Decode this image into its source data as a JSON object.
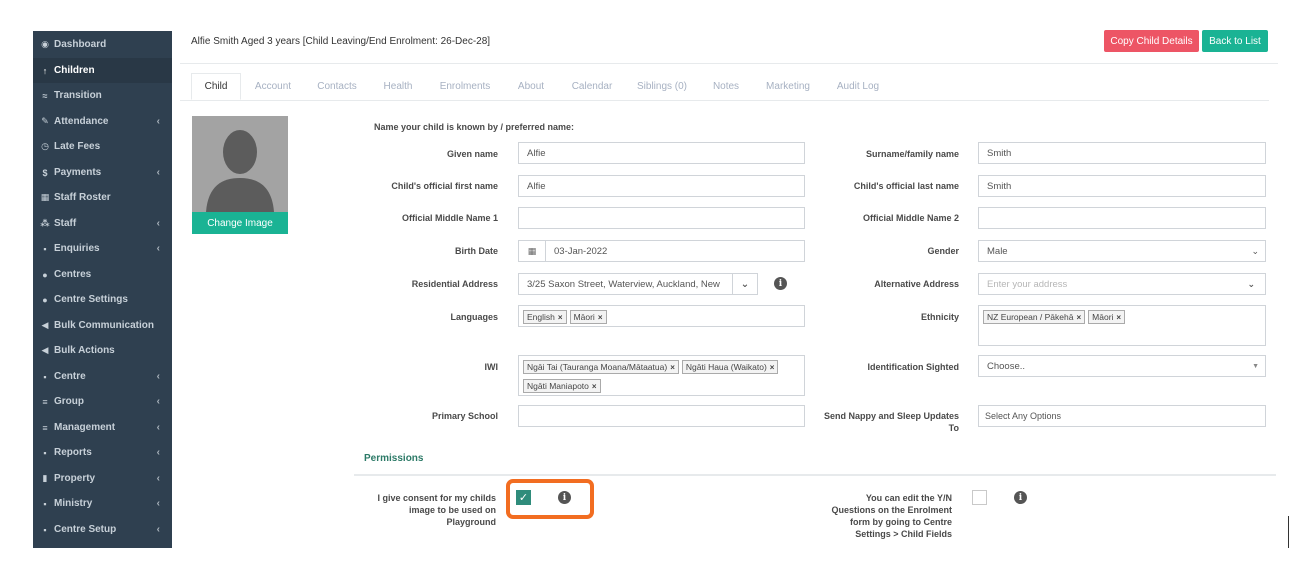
{
  "sidebar": {
    "items": [
      {
        "icon": "dashboard-icon",
        "glyph": "◉",
        "label": "Dashboard",
        "chevron": false
      },
      {
        "icon": "child-icon",
        "glyph": "↑",
        "label": "Children",
        "chevron": false,
        "active": true
      },
      {
        "icon": "graduation-icon",
        "glyph": "≈",
        "label": "Transition",
        "chevron": false
      },
      {
        "icon": "edit-icon",
        "glyph": "✎",
        "label": "Attendance",
        "chevron": true
      },
      {
        "icon": "clock-icon",
        "glyph": "◷",
        "label": "Late Fees",
        "chevron": false
      },
      {
        "icon": "dollar-icon",
        "glyph": "$",
        "label": "Payments",
        "chevron": true
      },
      {
        "icon": "calendar-icon",
        "glyph": "▦",
        "label": "Staff Roster",
        "chevron": false
      },
      {
        "icon": "sitemap-icon",
        "glyph": "⁂",
        "label": "Staff",
        "chevron": true
      },
      {
        "icon": "grid-icon",
        "glyph": "▪",
        "label": "Enquiries",
        "chevron": true
      },
      {
        "icon": "circle-icon",
        "glyph": "●",
        "label": "Centres",
        "chevron": false
      },
      {
        "icon": "circle-icon",
        "glyph": "●",
        "label": "Centre Settings",
        "chevron": false
      },
      {
        "icon": "bullhorn-icon",
        "glyph": "◀",
        "label": "Bulk Communication",
        "chevron": false
      },
      {
        "icon": "bullhorn-icon",
        "glyph": "◀",
        "label": "Bulk Actions",
        "chevron": false
      },
      {
        "icon": "grid-icon",
        "glyph": "▪",
        "label": "Centre",
        "chevron": true
      },
      {
        "icon": "list-icon",
        "glyph": "≡",
        "label": "Group",
        "chevron": true
      },
      {
        "icon": "list-icon",
        "glyph": "≡",
        "label": "Management",
        "chevron": true
      },
      {
        "icon": "grid-icon",
        "glyph": "▪",
        "label": "Reports",
        "chevron": true
      },
      {
        "icon": "building-icon",
        "glyph": "▮",
        "label": "Property",
        "chevron": true
      },
      {
        "icon": "grid-icon",
        "glyph": "▪",
        "label": "Ministry",
        "chevron": true
      },
      {
        "icon": "grid-icon",
        "glyph": "▪",
        "label": "Centre Setup",
        "chevron": true
      }
    ],
    "chevron_glyph": "‹"
  },
  "header": {
    "title": "Alfie Smith Aged 3 years [Child Leaving/End Enrolment: 26-Dec-28]",
    "copy_button": "Copy Child Details",
    "back_button": "Back to List"
  },
  "tabs": [
    "Child",
    "Account",
    "Contacts",
    "Health",
    "Enrolments",
    "About",
    "Calendar",
    "Siblings (0)",
    "Notes",
    "Marketing",
    "Audit Log"
  ],
  "avatar": {
    "change_image": "Change Image"
  },
  "form": {
    "preferred_heading": "Name your child is known by / preferred name:",
    "given_name_label": "Given name",
    "given_name": "Alfie",
    "surname_label": "Surname/family name",
    "surname": "Smith",
    "official_first_label": "Child's official first name",
    "official_first": "Alfie",
    "official_last_label": "Child's official last name",
    "official_last": "Smith",
    "middle1_label": "Official Middle Name 1",
    "middle2_label": "Official Middle Name 2",
    "birth_date_label": "Birth Date",
    "birth_date": "03-Jan-2022",
    "gender_label": "Gender",
    "gender": "Male",
    "residential_label": "Residential Address",
    "residential": "3/25 Saxon Street, Waterview, Auckland, New",
    "alt_address_label": "Alternative Address",
    "alt_address_placeholder": "Enter your address",
    "languages_label": "Languages",
    "languages": [
      "English",
      "Māori"
    ],
    "ethnicity_label": "Ethnicity",
    "ethnicity": [
      "NZ European / Pākehā",
      "Māori"
    ],
    "iwi_label": "IWI",
    "iwi": [
      "Ngāi Tai (Tauranga Moana/Mātaatua)",
      "Ngāti Haua (Waikato)",
      "Ngāti Maniapoto"
    ],
    "id_sighted_label": "Identification Sighted",
    "id_sighted": "Choose..",
    "primary_school_label": "Primary School",
    "nappy_label": "Send Nappy and Sleep Updates To",
    "nappy_placeholder": "Select Any Options"
  },
  "permissions": {
    "title": "Permissions",
    "consent_label": "I give consent for my childs image to be used on Playground",
    "consent_checked": true,
    "yn_label": "You can edit the Y/N Questions on the Enrolment form by going to Centre Settings > Child Fields",
    "yn_checked": false
  },
  "colors": {
    "sidebar": "#2f4050",
    "primary": "#1ab394",
    "danger": "#ed5565",
    "highlight": "#f26d21"
  }
}
